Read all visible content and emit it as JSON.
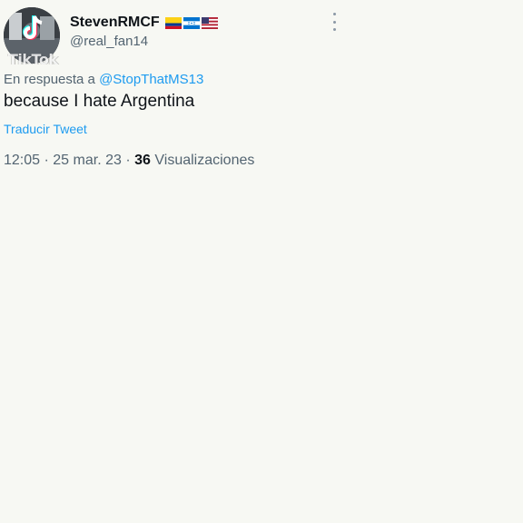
{
  "tweet": {
    "display_name": "StevenRMCF",
    "flags": [
      "colombia-flag",
      "honduras-flag",
      "usa-flag"
    ],
    "handle": "@real_fan14",
    "reply_prefix": "En respuesta a",
    "reply_mention": "@StopThatMS13",
    "text": "because I hate Argentina",
    "translate_label": "Traducir Tweet",
    "time": "12:05",
    "separator": "·",
    "date": "25 mar. 23",
    "views_count": "36",
    "views_label": "Visualizaciones"
  },
  "watermark": {
    "logo_text": "TikTok"
  },
  "colors": {
    "background": "#f7f8f3",
    "link": "#1d9bf0",
    "secondary_text": "#536471",
    "primary_text": "#0f1419"
  }
}
